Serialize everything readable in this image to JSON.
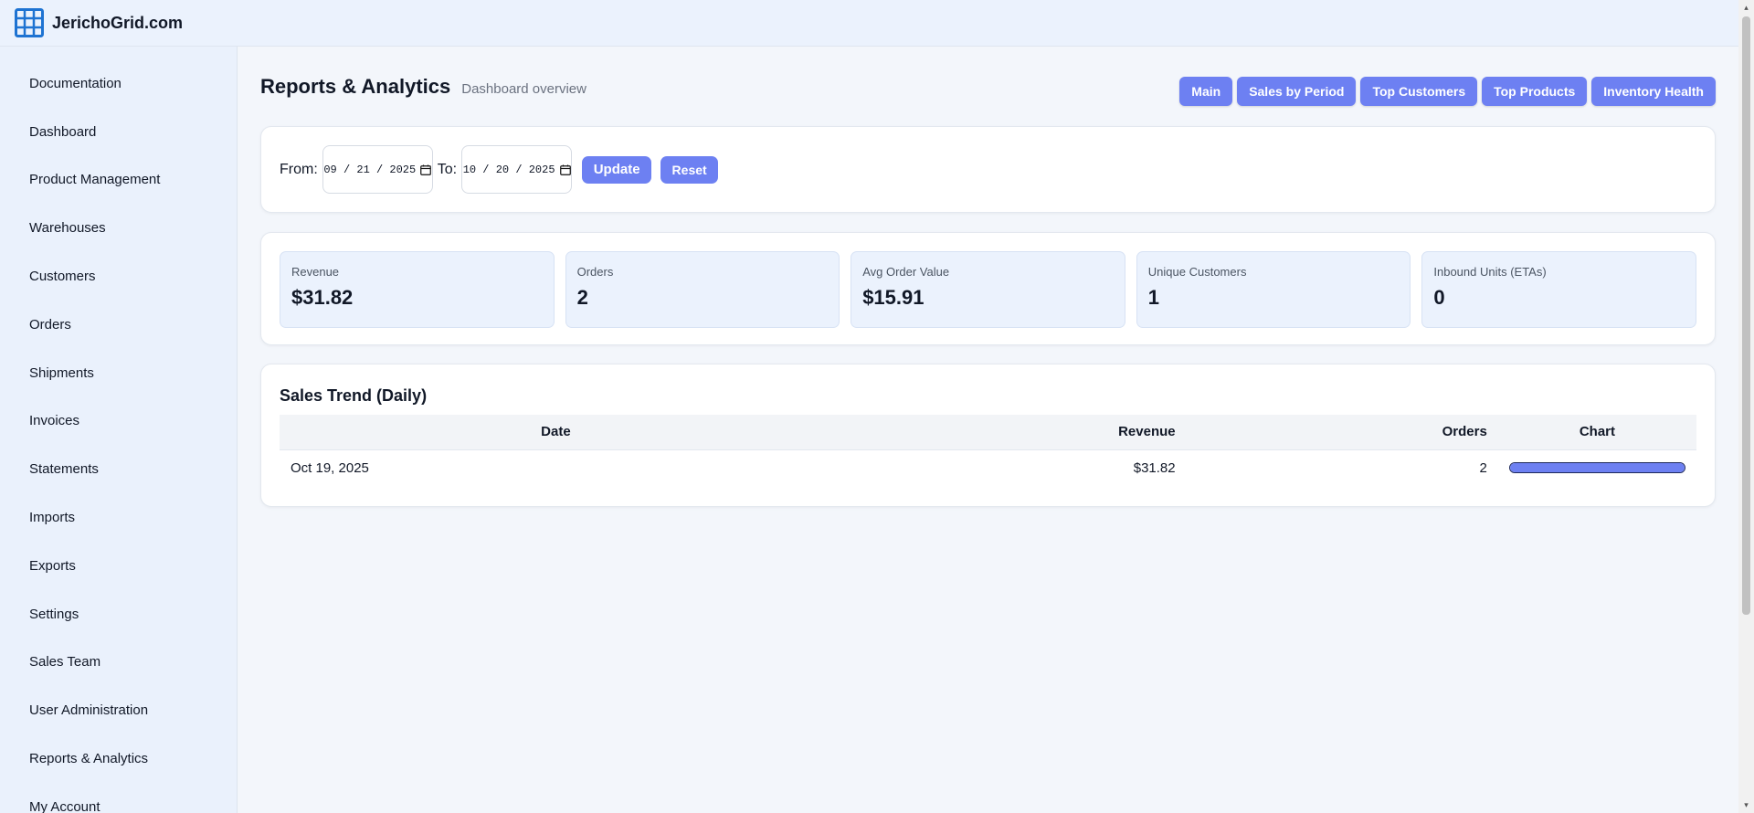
{
  "brand": {
    "name": "JerichoGrid.com",
    "icon": "grid-icon",
    "color": "#1e73d2"
  },
  "sidebar": {
    "items": [
      {
        "label": "Documentation"
      },
      {
        "label": "Dashboard"
      },
      {
        "label": "Product Management"
      },
      {
        "label": "Warehouses"
      },
      {
        "label": "Customers"
      },
      {
        "label": "Orders"
      },
      {
        "label": "Shipments"
      },
      {
        "label": "Invoices"
      },
      {
        "label": "Statements"
      },
      {
        "label": "Imports"
      },
      {
        "label": "Exports"
      },
      {
        "label": "Settings"
      },
      {
        "label": "Sales Team"
      },
      {
        "label": "User Administration"
      },
      {
        "label": "Reports & Analytics"
      },
      {
        "label": "My Account"
      }
    ]
  },
  "page": {
    "title": "Reports & Analytics",
    "subtitle": "Dashboard overview"
  },
  "tabs": [
    {
      "label": "Main"
    },
    {
      "label": "Sales by Period"
    },
    {
      "label": "Top Customers"
    },
    {
      "label": "Top Products"
    },
    {
      "label": "Inventory Health"
    }
  ],
  "filter": {
    "from_label": "From:",
    "from_value": "09 / 21 / 2025",
    "to_label": "To:",
    "to_value": "10 / 20 / 2025",
    "update_label": "Update",
    "reset_label": "Reset"
  },
  "kpis": [
    {
      "label": "Revenue",
      "value": "$31.82"
    },
    {
      "label": "Orders",
      "value": "2"
    },
    {
      "label": "Avg Order Value",
      "value": "$15.91"
    },
    {
      "label": "Unique Customers",
      "value": "1"
    },
    {
      "label": "Inbound Units (ETAs)",
      "value": "0"
    }
  ],
  "trend": {
    "title": "Sales Trend (Daily)",
    "columns": [
      "Date",
      "Revenue",
      "Orders",
      "Chart"
    ],
    "rows": [
      {
        "date": "Oct 19, 2025",
        "revenue": "$31.82",
        "orders": "2",
        "bar_fraction": 1.0
      }
    ]
  },
  "colors": {
    "accent": "#6d80f2",
    "kpi_bg": "#ebf2fd"
  }
}
